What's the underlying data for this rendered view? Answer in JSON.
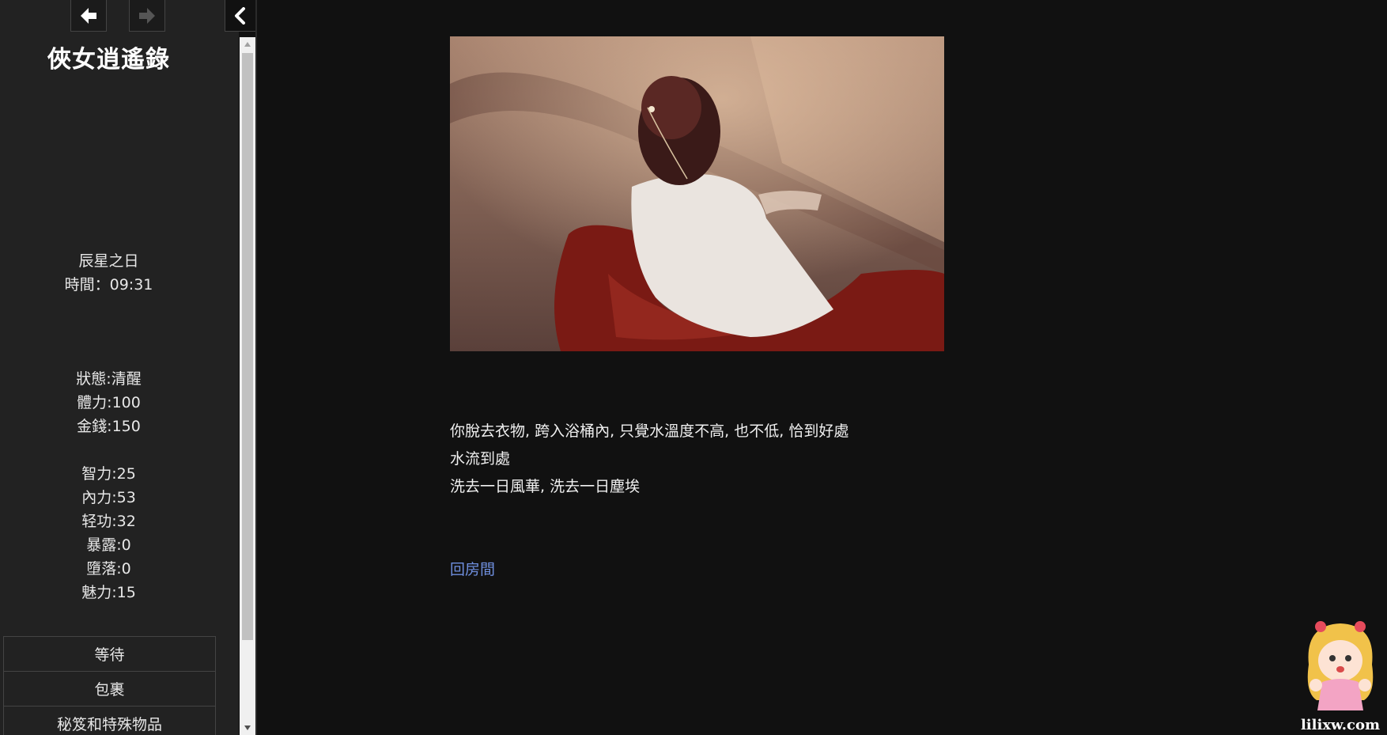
{
  "sidebar": {
    "title": "俠女逍遙錄",
    "date": "辰星之日",
    "time_label": "時間：",
    "time_value": "09:31",
    "status": [
      {
        "key": "狀態:",
        "value": "清醒"
      },
      {
        "key": "體力:",
        "value": "100"
      },
      {
        "key": "金錢:",
        "value": "150"
      }
    ],
    "attributes": [
      {
        "key": "智力:",
        "value": "25"
      },
      {
        "key": "內力:",
        "value": "53"
      },
      {
        "key": "轻功:",
        "value": "32"
      },
      {
        "key": "暴露:",
        "value": "0"
      },
      {
        "key": "墮落:",
        "value": "0"
      },
      {
        "key": "魅力:",
        "value": "15"
      }
    ],
    "menu": [
      "等待",
      "包裹",
      "秘笈和特殊物品"
    ],
    "nav_icons": {
      "back": "arrow-left-icon",
      "forward": "arrow-right-icon",
      "collapse": "chevron-left-icon"
    }
  },
  "passage": {
    "lines": [
      "你脫去衣物, 跨入浴桶內, 只覺水溫度不高, 也不低, 恰到好處",
      "水流到處",
      "洗去一日風華, 洗去一日塵埃"
    ],
    "link": "回房間"
  },
  "watermark": {
    "text": "lilixw.com"
  },
  "colors": {
    "background": "#111111",
    "sidebar": "#222222",
    "link": "#6f8fdf",
    "text": "#f0f0f0"
  }
}
